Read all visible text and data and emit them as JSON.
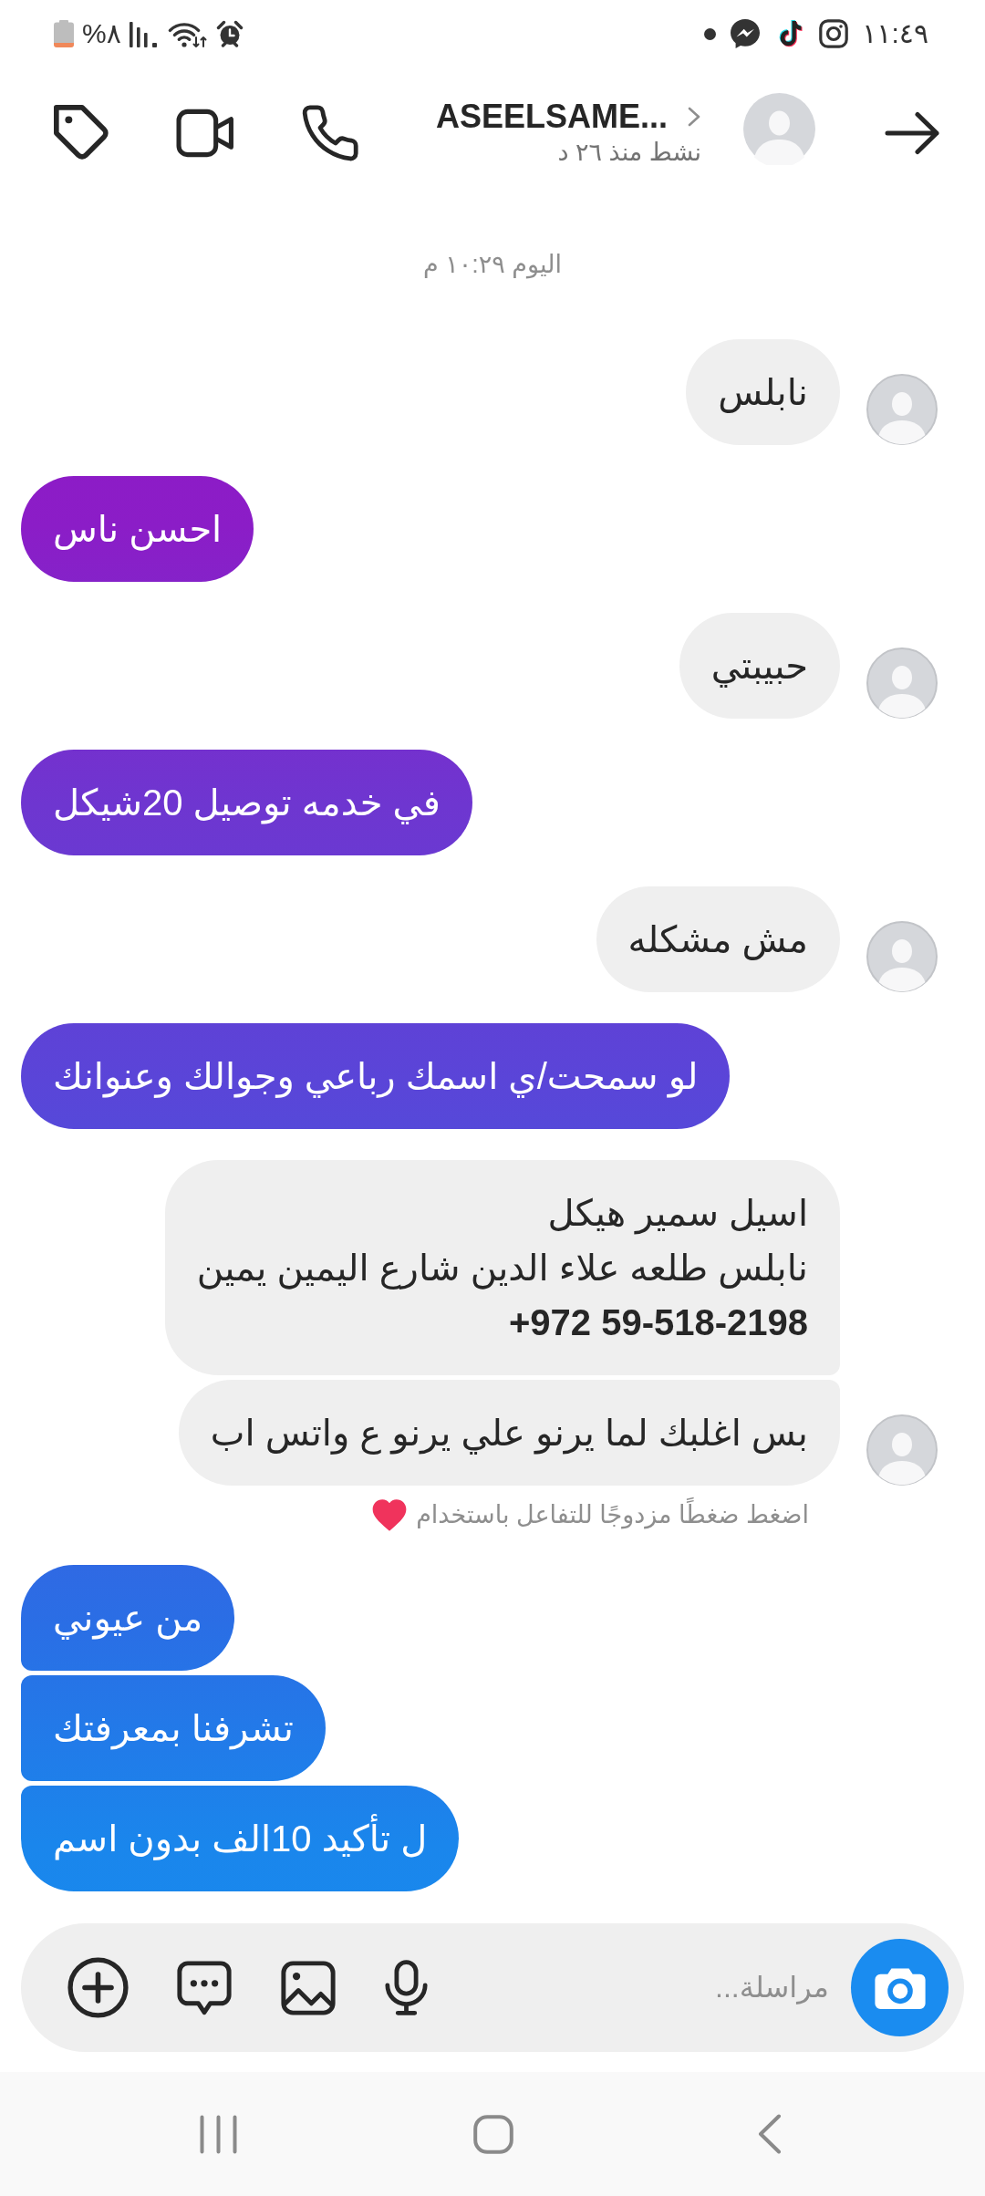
{
  "status_bar": {
    "battery": "%٨",
    "time": "١١:٤٩"
  },
  "header": {
    "name": "ASEELSAME...",
    "status": "نشط منذ ٢٦ د"
  },
  "messages": [
    {
      "kind": "timestamp",
      "text": "اليوم ١٠:٢٩ م"
    },
    {
      "kind": "incoming",
      "text": "نابلس"
    },
    {
      "kind": "outgoing",
      "text": "احسن ناس"
    },
    {
      "kind": "incoming",
      "text": "حبيبتي"
    },
    {
      "kind": "outgoing",
      "text": "في خدمه توصيل 20شيكل"
    },
    {
      "kind": "incoming",
      "text": "مش مشكله"
    },
    {
      "kind": "outgoing",
      "text": "لو سمحت/ي اسمك رباعي وجوالك وعنوانك"
    },
    {
      "kind": "incoming",
      "text": "اسيل سمير هيكل\nنابلس طلعه علاء الدين شارع اليمين يمين\n**+972 59-518-2198**"
    },
    {
      "kind": "incoming",
      "text": "بس اغلبك لما يرنو علي يرنو ع واتس اب"
    },
    {
      "kind": "hint",
      "text": "اضغط ضغطًا مزدوجًا للتفاعل باستخدام"
    },
    {
      "kind": "outgoing",
      "text": "من عيوني"
    },
    {
      "kind": "outgoing",
      "text": "تشرفنا بمعرفتك"
    },
    {
      "kind": "outgoing",
      "text": "ل تأكيد 10الف بدون اسم"
    }
  ],
  "composer": {
    "placeholder": "مراسلة..."
  }
}
